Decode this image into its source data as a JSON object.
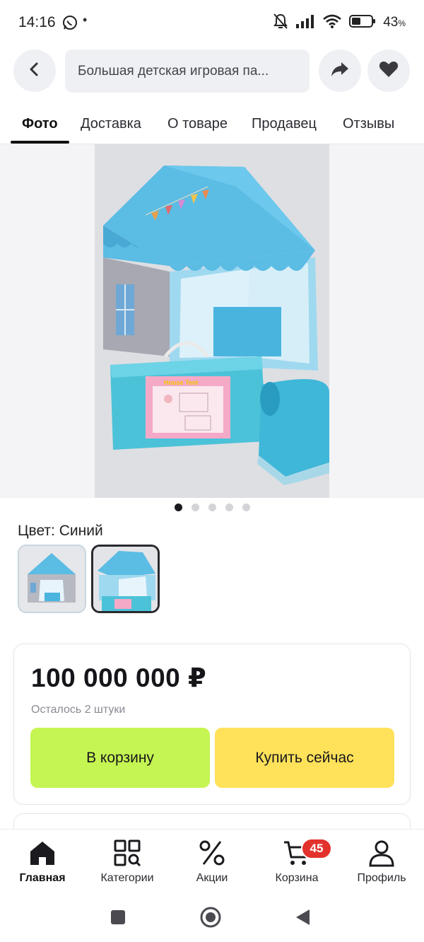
{
  "status_bar": {
    "time": "14:16",
    "dot": "•",
    "battery_percent": "43",
    "percent_sign": "%",
    "icons": [
      "whatsapp-icon",
      "mute-icon",
      "signal-icon",
      "wifi-icon",
      "battery-icon"
    ]
  },
  "header": {
    "search_text": "Большая детская игровая па...",
    "icons": [
      "back-arrow-icon",
      "share-icon",
      "heart-icon"
    ]
  },
  "tabs": [
    {
      "label": "Фото",
      "active": true
    },
    {
      "label": "Доставка",
      "active": false
    },
    {
      "label": "О товаре",
      "active": false
    },
    {
      "label": "Продавец",
      "active": false
    },
    {
      "label": "Отзывы",
      "active": false
    }
  ],
  "gallery": {
    "total_images": 5,
    "active_index": 0,
    "package_label": "House Tent"
  },
  "variant": {
    "label": "Цвет: Синий",
    "selected_index": 1
  },
  "product": {
    "price": "100 000 000 ₽",
    "stock": "Осталось 2 штуки",
    "add_to_cart": "В корзину",
    "buy_now": "Купить сейчас"
  },
  "bottom_nav": [
    {
      "label": "Главная",
      "icon": "home-icon",
      "active": true
    },
    {
      "label": "Категории",
      "icon": "categories-icon",
      "active": false
    },
    {
      "label": "Акции",
      "icon": "percent-icon",
      "active": false
    },
    {
      "label": "Корзина",
      "icon": "cart-icon",
      "active": false,
      "badge": "45"
    },
    {
      "label": "Профиль",
      "icon": "profile-icon",
      "active": false
    }
  ],
  "colors": {
    "cart_button": "#c5f552",
    "buy_button": "#ffe15a",
    "badge": "#e3322c",
    "tent_blue": "#5bbce4"
  }
}
